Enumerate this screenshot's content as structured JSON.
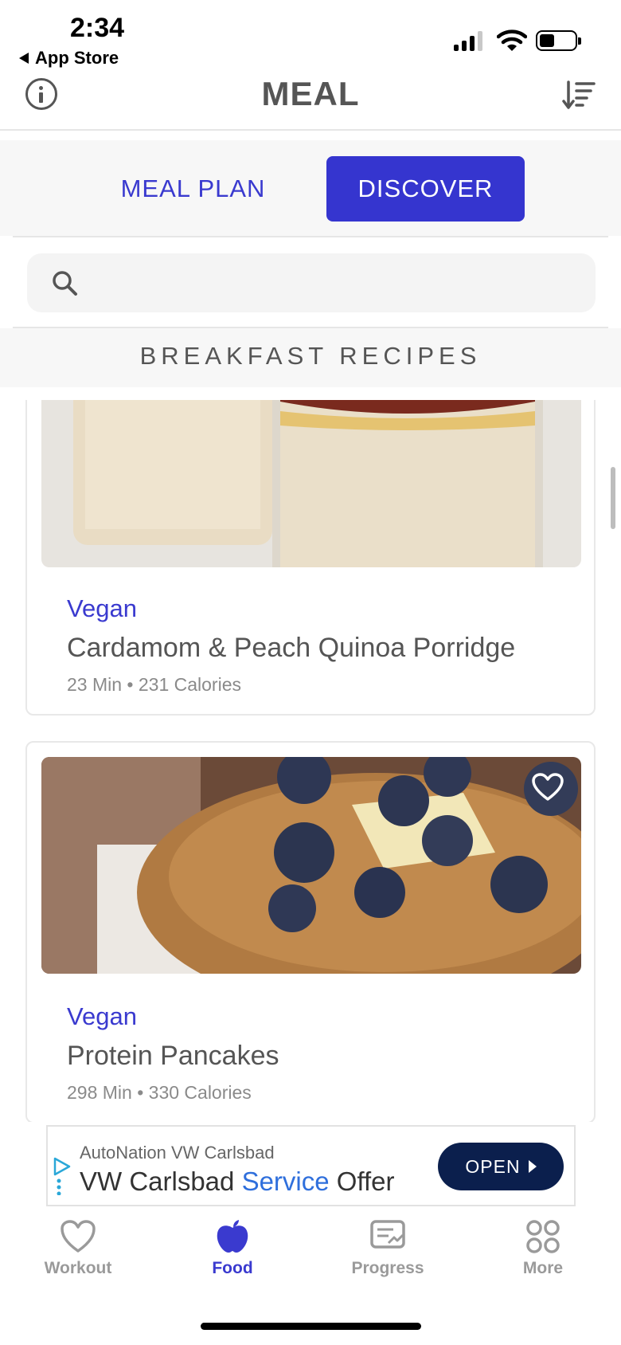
{
  "status_bar": {
    "time": "2:34",
    "back_app": "App Store"
  },
  "header": {
    "title": "MEAL"
  },
  "segments": {
    "meal_plan": "MEAL PLAN",
    "discover": "DISCOVER",
    "active": "DISCOVER"
  },
  "search": {
    "placeholder": "",
    "value": ""
  },
  "section_heading": "BREAKFAST RECIPES",
  "recipes": [
    {
      "tag": "Vegan",
      "title": "Cardamom & Peach Quinoa Porridge",
      "meta": "23 Min • 231 Calories"
    },
    {
      "tag": "Vegan",
      "title": "Protein Pancakes",
      "meta": "298 Min • 330 Calories"
    }
  ],
  "ad": {
    "advertiser": "AutoNation VW Carlsbad",
    "headline_start": "VW Carlsbad ",
    "headline_highlight": "Service",
    "headline_end": " Offer",
    "cta": "OPEN"
  },
  "tabs": [
    {
      "label": "Workout",
      "icon": "heart-icon"
    },
    {
      "label": "Food",
      "icon": "apple-icon"
    },
    {
      "label": "Progress",
      "icon": "progress-icon"
    },
    {
      "label": "More",
      "icon": "grid-icon"
    }
  ],
  "colors": {
    "accent": "#3535cf",
    "ad_button": "#0b1f4d",
    "ad_highlight": "#2f6fdc"
  }
}
